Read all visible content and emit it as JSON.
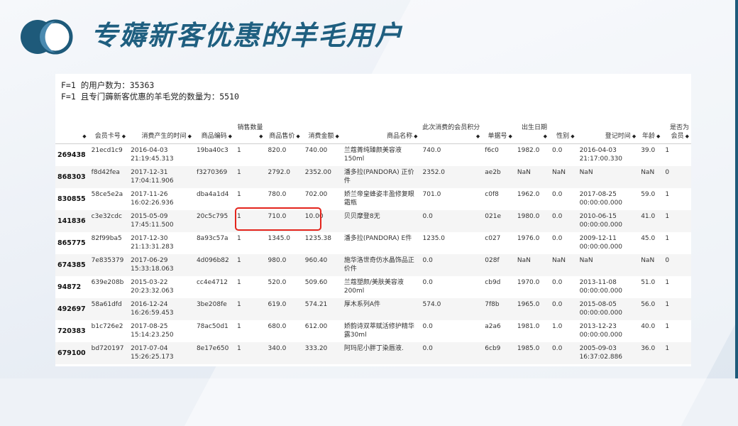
{
  "slide": {
    "title": "专薅新客优惠的羊毛用户",
    "colors": {
      "accent": "#1f5f80",
      "highlight": "#e3241c",
      "logo_dark": "#1e5a7a",
      "logo_light": "#4a8ab0"
    }
  },
  "stats": {
    "line1": "F=1 的用户数为：35363",
    "line2": "F=1 且专门薅新客优惠的羊毛党的数量为：5510"
  },
  "table": {
    "sort_icon": "◆",
    "headers": [
      "",
      "会员卡号",
      "消费产生的时间",
      "商品编码",
      "销售数量",
      "商品售价",
      "消费金额",
      "商品名称",
      "此次消费的会员积分",
      "单据号",
      "出生日期",
      "性别",
      "登记时间",
      "年龄",
      "是否为会员"
    ],
    "rows": [
      {
        "idx": "269438",
        "card": "21ecd1c9",
        "time": "2016-04-03 21:19:45.313",
        "code": "19ba40c3",
        "qty": "1",
        "price": "820.0",
        "amount": "740.00",
        "name": "兰蔻菁纯臻颜美容液150ml",
        "points": "740.0",
        "doc": "f6c0",
        "birth": "1982.0",
        "sex": "0.0",
        "reg": "2016-04-03 21:17:00.330",
        "age": "39.0",
        "member": "1"
      },
      {
        "idx": "868303",
        "card": "f8d42fea",
        "time": "2017-12-31 17:04:11.906",
        "code": "f3270369",
        "qty": "1",
        "price": "2792.0",
        "amount": "2352.00",
        "name": "潘多拉(PANDORA) 正价件",
        "points": "2352.0",
        "doc": "ae2b",
        "birth": "NaN",
        "sex": "NaN",
        "reg": "NaN",
        "age": "NaN",
        "member": "0"
      },
      {
        "idx": "830855",
        "card": "58ce5e2a",
        "time": "2017-11-26 16:02:26.936",
        "code": "dba4a1d4",
        "qty": "1",
        "price": "780.0",
        "amount": "702.00",
        "name": "娇兰帝皇蜂姿丰盈修复眼霜瓶",
        "points": "701.0",
        "doc": "c0f8",
        "birth": "1962.0",
        "sex": "0.0",
        "reg": "2017-08-25 00:00:00.000",
        "age": "59.0",
        "member": "1"
      },
      {
        "idx": "141836",
        "card": "c3e32cdc",
        "time": "2015-05-09 17:45:11.500",
        "code": "20c5c795",
        "qty": "1",
        "price": "710.0",
        "amount": "10.00",
        "name": "贝贝摩登8无",
        "points": "0.0",
        "doc": "021e",
        "birth": "1980.0",
        "sex": "0.0",
        "reg": "2010-06-15 00:00:00.000",
        "age": "41.0",
        "member": "1"
      },
      {
        "idx": "865775",
        "card": "82f99ba5",
        "time": "2017-12-30 21:13:31.283",
        "code": "8a93c57a",
        "qty": "1",
        "price": "1345.0",
        "amount": "1235.38",
        "name": "潘多拉(PANDORA) E件",
        "points": "1235.0",
        "doc": "c027",
        "birth": "1976.0",
        "sex": "0.0",
        "reg": "2009-12-11 00:00:00.000",
        "age": "45.0",
        "member": "1"
      },
      {
        "idx": "674385",
        "card": "7e835379",
        "time": "2017-06-29 15:33:18.063",
        "code": "4d096b82",
        "qty": "1",
        "price": "980.0",
        "amount": "960.40",
        "name": "施华洛世奇仿水晶饰品正价件",
        "points": "0.0",
        "doc": "028f",
        "birth": "NaN",
        "sex": "NaN",
        "reg": "NaN",
        "age": "NaN",
        "member": "0"
      },
      {
        "idx": "94872",
        "card": "639e208b",
        "time": "2015-03-22 20:23:32.063",
        "code": "cc4e4712",
        "qty": "1",
        "price": "520.0",
        "amount": "509.60",
        "name": "兰蔻塑颜/美肤美容液200ml",
        "points": "0.0",
        "doc": "cb9d",
        "birth": "1970.0",
        "sex": "0.0",
        "reg": "2013-11-08 00:00:00.000",
        "age": "51.0",
        "member": "1"
      },
      {
        "idx": "492697",
        "card": "58a61dfd",
        "time": "2016-12-24 16:26:59.453",
        "code": "3be208fe",
        "qty": "1",
        "price": "619.0",
        "amount": "574.21",
        "name": "厚木系列A件",
        "points": "574.0",
        "doc": "7f8b",
        "birth": "1965.0",
        "sex": "0.0",
        "reg": "2015-08-05 00:00:00.000",
        "age": "56.0",
        "member": "1"
      },
      {
        "idx": "720383",
        "card": "b1c726e2",
        "time": "2017-08-25 15:14:23.250",
        "code": "78ac50d1",
        "qty": "1",
        "price": "680.0",
        "amount": "612.00",
        "name": "娇韵诗双萃赋活修护精华露30ml",
        "points": "0.0",
        "doc": "a2a6",
        "birth": "1981.0",
        "sex": "1.0",
        "reg": "2013-12-23 00:00:00.000",
        "age": "40.0",
        "member": "1"
      },
      {
        "idx": "679100",
        "card": "bd720197",
        "time": "2017-07-04 15:26:25.173",
        "code": "8e17e650",
        "qty": "1",
        "price": "340.0",
        "amount": "333.20",
        "name": "阿玛尼小胖丁染唇液.",
        "points": "0.0",
        "doc": "6cb9",
        "birth": "1985.0",
        "sex": "0.0",
        "reg": "2005-09-03 16:37:02.886",
        "age": "36.0",
        "member": "1"
      }
    ]
  }
}
